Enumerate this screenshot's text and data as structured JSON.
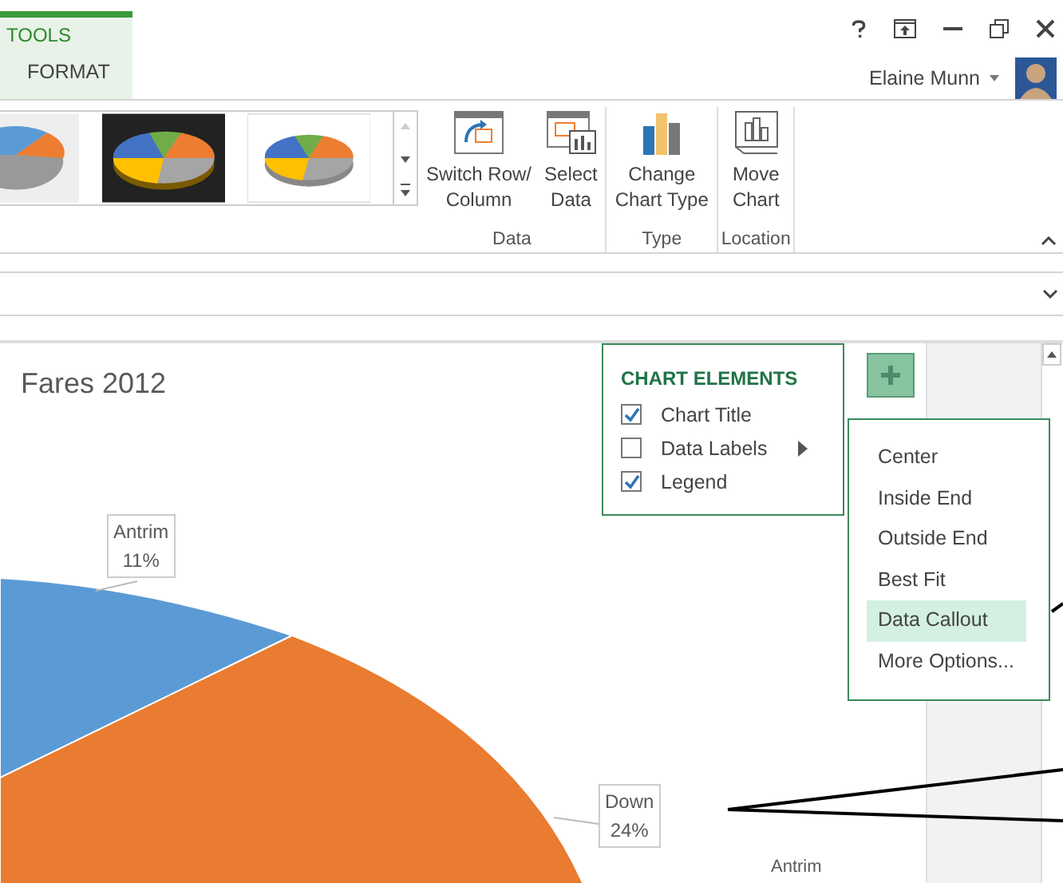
{
  "ribbon_tabs": {
    "context_title": "TOOLS",
    "tabs": [
      {
        "label": "FORMAT",
        "selected": true
      }
    ]
  },
  "user": {
    "name": "Elaine Munn"
  },
  "ribbon_groups": [
    {
      "label": "Data",
      "buttons": [
        {
          "kind": "switch",
          "lines": [
            "Switch Row/",
            "Column"
          ]
        },
        {
          "kind": "select",
          "lines": [
            "Select",
            "Data"
          ]
        }
      ]
    },
    {
      "label": "Type",
      "buttons": [
        {
          "kind": "bars",
          "lines": [
            "Change",
            "Chart Type"
          ]
        }
      ]
    },
    {
      "label": "Location",
      "buttons": [
        {
          "kind": "move",
          "lines": [
            "Move",
            "Chart"
          ]
        }
      ]
    }
  ],
  "chart": {
    "title": "Fares 2012",
    "data_labels": [
      {
        "name": "Antrim",
        "percent": "11%"
      },
      {
        "name": "Down",
        "percent": "24%"
      }
    ],
    "legend": [
      "Antrim"
    ]
  },
  "chart_elements": {
    "title": "CHART ELEMENTS",
    "items": [
      {
        "label": "Chart Title",
        "checked": true,
        "has_submenu": false
      },
      {
        "label": "Data Labels",
        "checked": false,
        "has_submenu": true
      },
      {
        "label": "Legend",
        "checked": true,
        "has_submenu": false
      }
    ]
  },
  "data_labels_menu": [
    {
      "label": "Center",
      "selected": false
    },
    {
      "label": "Inside End",
      "selected": false
    },
    {
      "label": "Outside End",
      "selected": false
    },
    {
      "label": "Best Fit",
      "selected": false
    },
    {
      "label": "Data Callout",
      "selected": true
    },
    {
      "label": "More Options...",
      "selected": false
    }
  ]
}
